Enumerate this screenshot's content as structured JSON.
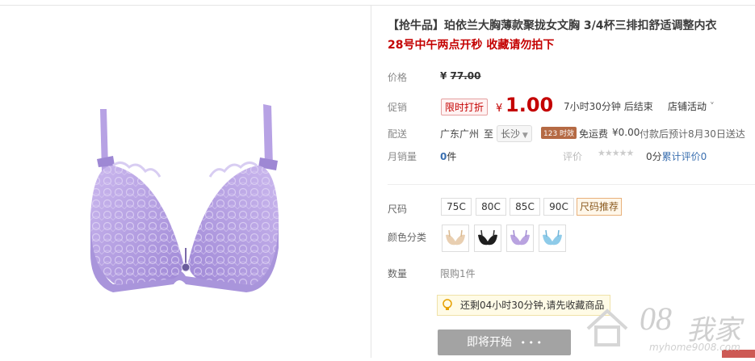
{
  "product": {
    "title": "【抢牛品】珀依兰大胸薄款聚拢女文胸 3/4杯三排扣舒适调整内衣",
    "subtitle": "28号中午两点开秒 收藏请勿拍下"
  },
  "price": {
    "label": "价格",
    "currency": "¥",
    "original": "77.00"
  },
  "promotion": {
    "label": "促销",
    "tag": "限时打折",
    "currency": "¥",
    "price": "1.00",
    "countdown": "7小时30分钟 后结束",
    "shop_activity": "店铺活动"
  },
  "delivery": {
    "label": "配送",
    "from": "广东广州",
    "to_word": "至",
    "city": "长沙",
    "badge": "123 时效",
    "free_shipping": "免运费",
    "fee": "¥0.00",
    "eta": "付款后预计8月30日送达"
  },
  "sales": {
    "label": "月销量",
    "count": "0",
    "unit": "件",
    "review_label": "评价",
    "stars": "★★★★★",
    "score": "0分",
    "review_link": "累计评价0"
  },
  "size": {
    "label": "尺码",
    "options": [
      "75C",
      "80C",
      "85C",
      "90C"
    ],
    "recommend": "尺码推荐"
  },
  "color": {
    "label": "颜色分类",
    "swatches": [
      {
        "name": "skin",
        "hex": "#e9cfb1"
      },
      {
        "name": "black",
        "hex": "#1e1e1e"
      },
      {
        "name": "purple",
        "hex": "#b9a3e0"
      },
      {
        "name": "blue",
        "hex": "#8ecbe9"
      }
    ]
  },
  "quantity": {
    "label": "数量",
    "limit": "限购1件"
  },
  "tip": {
    "text": "还剩04小时30分钟,请先收藏商品"
  },
  "start_button": {
    "label": "即将开始",
    "dots": "• • •"
  },
  "watermark": {
    "logo": "08",
    "brand": "我家",
    "url": "myhome9008.com"
  },
  "colors": {
    "accent_red": "#c40000",
    "link_blue": "#3a6fb0",
    "button_gray": "#a3a3a3",
    "bra_purple": "#b9a3e0"
  }
}
